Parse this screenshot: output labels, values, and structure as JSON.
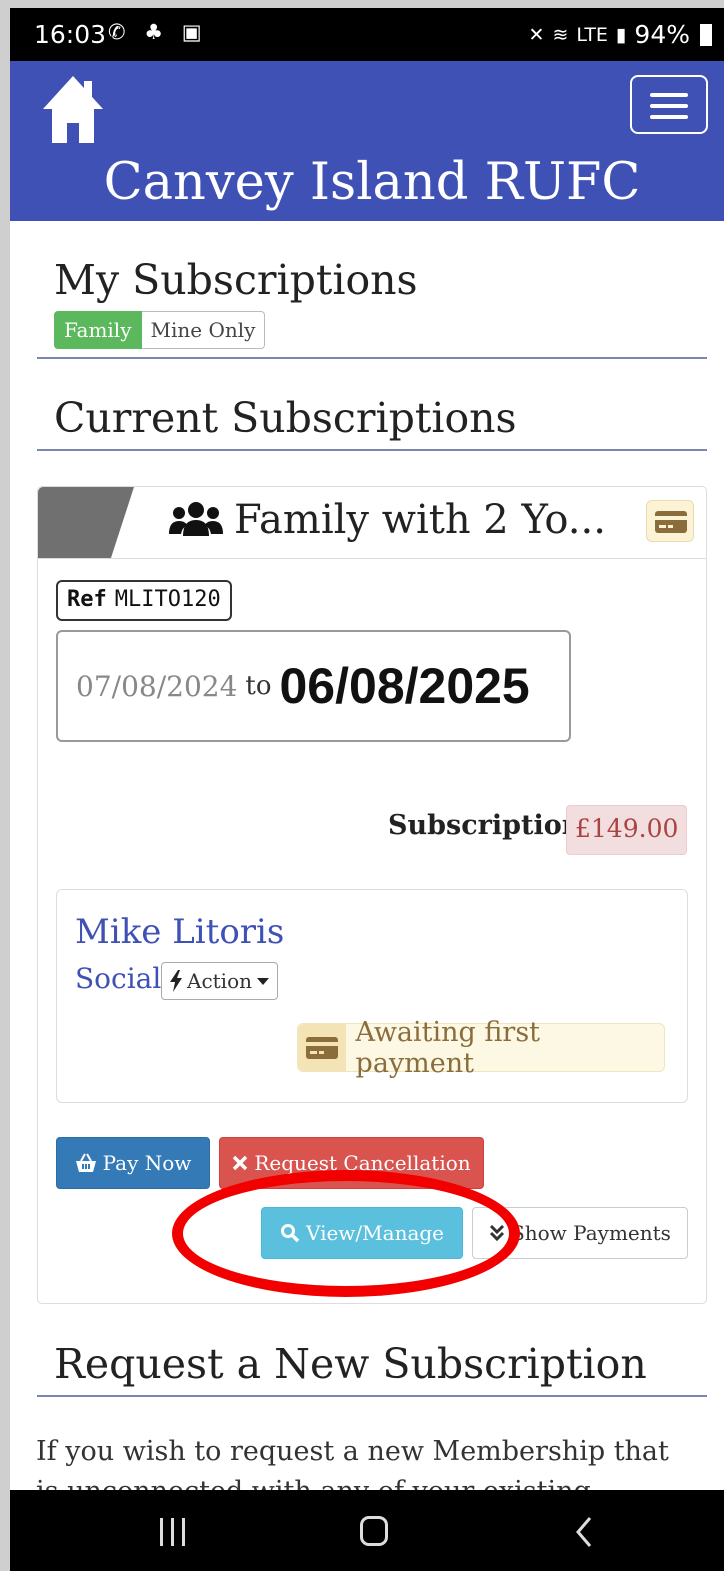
{
  "status_bar": {
    "time": "16:03",
    "battery": "94%",
    "network": "LTE"
  },
  "header": {
    "title": "Canvey Island RUFC"
  },
  "page": {
    "title": "My Subscriptions",
    "toggle": {
      "family": "Family",
      "mine_only": "Mine Only",
      "active": "Family"
    },
    "current_title": "Current Subscriptions"
  },
  "subscription": {
    "name": "Family with 2 Yo...",
    "ref_label": "Ref",
    "ref": "MLITO120",
    "from": "07/08/2024",
    "to_word": "to",
    "to": "06/08/2025",
    "price_label": "Subscription:",
    "price": "£149.00",
    "member": {
      "name": "Mike Litoris",
      "type": "Social",
      "action_label": "Action",
      "status": "Awaiting first payment"
    },
    "buttons": {
      "pay_now": "Pay Now",
      "request_cancellation": "Request Cancellation",
      "view_manage": "View/Manage",
      "show_payments": "Show Payments"
    }
  },
  "new_section": {
    "title": "Request a New Subscription",
    "text": "If you wish to request a new Membership that is unconnected with any of your existing"
  },
  "colors": {
    "navbar": "#3f51b5",
    "family_toggle": "#5cb85c",
    "pay_button": "#337ab7",
    "cancel_button": "#d9534f",
    "view_button": "#5bc0de",
    "highlight_ellipse": "#f20000"
  }
}
